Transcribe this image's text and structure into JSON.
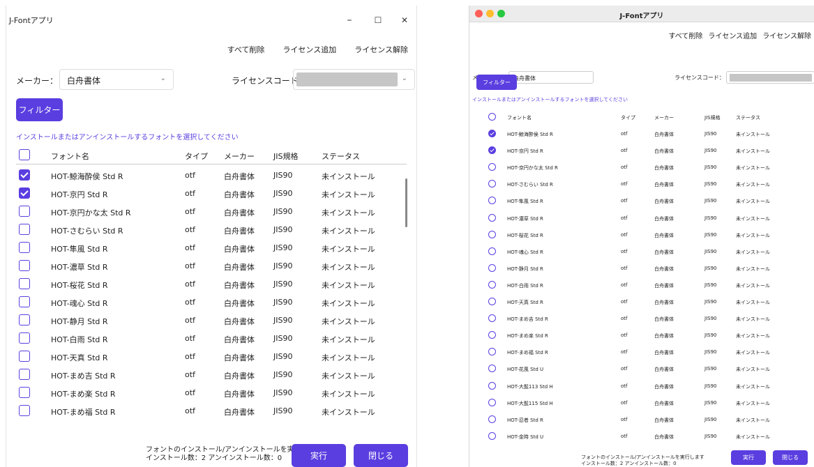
{
  "app_title": "J-Fontアプリ",
  "accent_color": "#5a3ee0",
  "actions": [
    "すべて削除",
    "ライセンス追加",
    "ライセンス解除"
  ],
  "maker_label": "メーカー：",
  "maker_value": "白舟書体",
  "license_label": "ライセンスコード：",
  "filter_label": "フィルター",
  "hint": "インストールまたはアンインストールするフォントを選択してください",
  "columns": [
    "フォント名",
    "タイプ",
    "メーカー",
    "JIS規格",
    "ステータス"
  ],
  "rows": [
    {
      "name": "HOT-鯨海酔侯 Std R",
      "type": "otf",
      "maker": "白舟書体",
      "jis": "JIS90",
      "status": "未インストール",
      "checked": true
    },
    {
      "name": "HOT-京円 Std R",
      "type": "otf",
      "maker": "白舟書体",
      "jis": "JIS90",
      "status": "未インストール",
      "checked": true
    },
    {
      "name": "HOT-京円かな太 Std R",
      "type": "otf",
      "maker": "白舟書体",
      "jis": "JIS90",
      "status": "未インストール",
      "checked": false
    },
    {
      "name": "HOT-さむらい Std R",
      "type": "otf",
      "maker": "白舟書体",
      "jis": "JIS90",
      "status": "未インストール",
      "checked": false
    },
    {
      "name": "HOT-隼風 Std R",
      "type": "otf",
      "maker": "白舟書体",
      "jis": "JIS90",
      "status": "未インストール",
      "checked": false
    },
    {
      "name": "HOT-濃草 Std R",
      "type": "otf",
      "maker": "白舟書体",
      "jis": "JIS90",
      "status": "未インストール",
      "checked": false
    },
    {
      "name": "HOT-桜花 Std R",
      "type": "otf",
      "maker": "白舟書体",
      "jis": "JIS90",
      "status": "未インストール",
      "checked": false
    },
    {
      "name": "HOT-魂心 Std R",
      "type": "otf",
      "maker": "白舟書体",
      "jis": "JIS90",
      "status": "未インストール",
      "checked": false
    },
    {
      "name": "HOT-静月 Std R",
      "type": "otf",
      "maker": "白舟書体",
      "jis": "JIS90",
      "status": "未インストール",
      "checked": false
    },
    {
      "name": "HOT-白雨 Std R",
      "type": "otf",
      "maker": "白舟書体",
      "jis": "JIS90",
      "status": "未インストール",
      "checked": false
    },
    {
      "name": "HOT-天真 Std R",
      "type": "otf",
      "maker": "白舟書体",
      "jis": "JIS90",
      "status": "未インストール",
      "checked": false
    },
    {
      "name": "HOT-まめ吉 Std R",
      "type": "otf",
      "maker": "白舟書体",
      "jis": "JIS90",
      "status": "未インストール",
      "checked": false
    },
    {
      "name": "HOT-まめ楽 Std R",
      "type": "otf",
      "maker": "白舟書体",
      "jis": "JIS90",
      "status": "未インストール",
      "checked": false
    },
    {
      "name": "HOT-まめ福 Std R",
      "type": "otf",
      "maker": "白舟書体",
      "jis": "JIS90",
      "status": "未インストール",
      "checked": false
    }
  ],
  "extra_rows_right": [
    {
      "name": "HOT-花風 Std U",
      "type": "otf",
      "maker": "白舟書体",
      "jis": "JIS90",
      "status": "未インストール",
      "checked": false
    },
    {
      "name": "HOT-大髭113 Std H",
      "type": "otf",
      "maker": "白舟書体",
      "jis": "JIS90",
      "status": "未インストール",
      "checked": false
    },
    {
      "name": "HOT-大髭115 Std H",
      "type": "otf",
      "maker": "白舟書体",
      "jis": "JIS90",
      "status": "未インストール",
      "checked": false
    },
    {
      "name": "HOT-忍者 Std R",
      "type": "otf",
      "maker": "白舟書体",
      "jis": "JIS90",
      "status": "未インストール",
      "checked": false
    },
    {
      "name": "HOT-金時 Std U",
      "type": "otf",
      "maker": "白舟書体",
      "jis": "JIS90",
      "status": "未インストール",
      "checked": false
    }
  ],
  "footer_line1": "フォントのインストール/アンインストールを実行します",
  "footer_line2": "インストール数：2 アンインストール数：0",
  "run_label": "実行",
  "close_label": "閉じる",
  "win_controls": [
    "–",
    "☐",
    "✕"
  ]
}
